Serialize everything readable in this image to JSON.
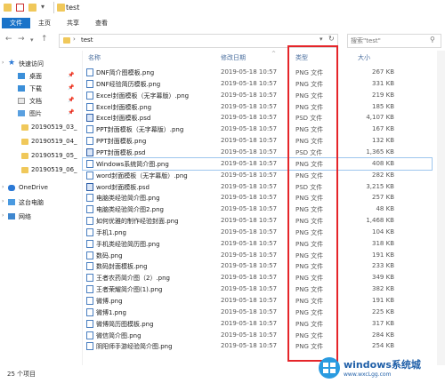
{
  "window": {
    "title": "test"
  },
  "ribbon": {
    "tabs": [
      "文件",
      "主页",
      "共享",
      "查看"
    ]
  },
  "address": {
    "path": "test",
    "search_placeholder": "搜索\"test\""
  },
  "nav": {
    "quick_access": "快速访问",
    "pinned": [
      "桌面",
      "下载",
      "文档",
      "图片"
    ],
    "folders": [
      "20190519_03_",
      "20190519_04_",
      "20190519_05_",
      "20190519_06_"
    ],
    "onedrive": "OneDrive",
    "this_pc": "这台电脑",
    "network": "网络"
  },
  "columns": {
    "name": "名称",
    "date": "修改日期",
    "type": "类型",
    "size": "大小"
  },
  "files": [
    {
      "name": "DNF简介图模板.png",
      "date": "2019-05-18 10:57",
      "type": "PNG 文件",
      "size": "267 KB",
      "kind": "png"
    },
    {
      "name": "DNF经验简历模板.png",
      "date": "2019-05-18 10:57",
      "type": "PNG 文件",
      "size": "331 KB",
      "kind": "png"
    },
    {
      "name": "Excel封面模板（无字幕版）.png",
      "date": "2019-05-18 10:57",
      "type": "PNG 文件",
      "size": "219 KB",
      "kind": "png"
    },
    {
      "name": "Excel封面模板.png",
      "date": "2019-05-18 10:57",
      "type": "PNG 文件",
      "size": "185 KB",
      "kind": "png"
    },
    {
      "name": "Excel封面模板.psd",
      "date": "2019-05-18 10:57",
      "type": "PSD 文件",
      "size": "4,107 KB",
      "kind": "psd"
    },
    {
      "name": "PPT封面模板（无字幕版）.png",
      "date": "2019-05-18 10:57",
      "type": "PNG 文件",
      "size": "167 KB",
      "kind": "png"
    },
    {
      "name": "PPT封面模板.png",
      "date": "2019-05-18 10:57",
      "type": "PNG 文件",
      "size": "132 KB",
      "kind": "png"
    },
    {
      "name": "PPT封面模板.psd",
      "date": "2019-05-18 10:57",
      "type": "PSD 文件",
      "size": "1,365 KB",
      "kind": "psd"
    },
    {
      "name": "Windows系统简介图.png",
      "date": "2019-05-18 10:57",
      "type": "PNG 文件",
      "size": "408 KB",
      "kind": "png"
    },
    {
      "name": "word封面模板（无字幕版）.png",
      "date": "2019-05-18 10:57",
      "type": "PNG 文件",
      "size": "282 KB",
      "kind": "png"
    },
    {
      "name": "word封面模板.psd",
      "date": "2019-05-18 10:57",
      "type": "PSD 文件",
      "size": "3,215 KB",
      "kind": "psd"
    },
    {
      "name": "电脑类经验简介图.png",
      "date": "2019-05-18 10:57",
      "type": "PNG 文件",
      "size": "257 KB",
      "kind": "png"
    },
    {
      "name": "电脑类经验简介图2.png",
      "date": "2019-05-18 10:57",
      "type": "PNG 文件",
      "size": "48 KB",
      "kind": "png"
    },
    {
      "name": "如何优雅的制作经验封面.png",
      "date": "2019-05-18 10:57",
      "type": "PNG 文件",
      "size": "1,468 KB",
      "kind": "png"
    },
    {
      "name": "手机1.png",
      "date": "2019-05-18 10:57",
      "type": "PNG 文件",
      "size": "104 KB",
      "kind": "png"
    },
    {
      "name": "手机类经验简历图.png",
      "date": "2019-05-18 10:57",
      "type": "PNG 文件",
      "size": "318 KB",
      "kind": "png"
    },
    {
      "name": "数码.png",
      "date": "2019-05-18 10:57",
      "type": "PNG 文件",
      "size": "191 KB",
      "kind": "png"
    },
    {
      "name": "数码封面模板.png",
      "date": "2019-05-18 10:57",
      "type": "PNG 文件",
      "size": "233 KB",
      "kind": "png"
    },
    {
      "name": "王者农药简介图（2）.png",
      "date": "2019-05-18 10:57",
      "type": "PNG 文件",
      "size": "349 KB",
      "kind": "png"
    },
    {
      "name": "王者荣耀简介图(1).png",
      "date": "2019-05-18 10:57",
      "type": "PNG 文件",
      "size": "382 KB",
      "kind": "png"
    },
    {
      "name": "微博.png",
      "date": "2019-05-18 10:57",
      "type": "PNG 文件",
      "size": "191 KB",
      "kind": "png"
    },
    {
      "name": "微博1.png",
      "date": "2019-05-18 10:57",
      "type": "PNG 文件",
      "size": "225 KB",
      "kind": "png"
    },
    {
      "name": "微博简历图模板.png",
      "date": "2019-05-18 10:57",
      "type": "PNG 文件",
      "size": "317 KB",
      "kind": "png"
    },
    {
      "name": "微信简介图.png",
      "date": "2019-05-18 10:57",
      "type": "PNG 文件",
      "size": "284 KB",
      "kind": "png"
    },
    {
      "name": "阴阳师手游经验简介图.png",
      "date": "2019-05-18 10:57",
      "type": "PNG 文件",
      "size": "254 KB",
      "kind": "png"
    }
  ],
  "status": {
    "count": "25 个项目"
  },
  "watermark": {
    "line1": "windows系统城",
    "line2": "www.wxcLgg.com"
  },
  "colors": {
    "accent": "#1a73c9",
    "highlight": "#e5252a",
    "folder": "#f0c85a"
  }
}
